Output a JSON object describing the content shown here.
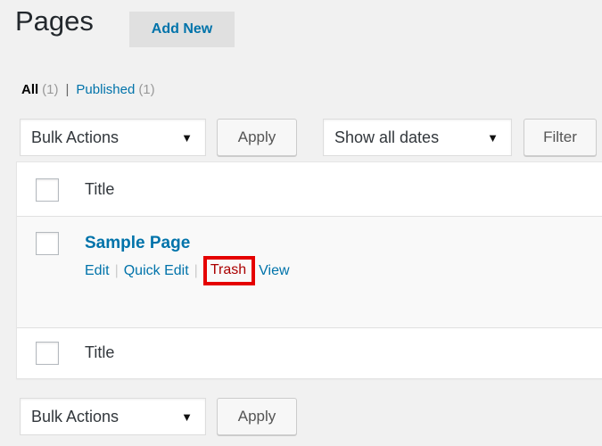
{
  "header": {
    "title": "Pages",
    "add_new_label": "Add New"
  },
  "filters": {
    "all_label": "All",
    "all_count": "(1)",
    "separator": "|",
    "published_label": "Published",
    "published_count": "(1)"
  },
  "top_controls": {
    "bulk_actions": "Bulk Actions",
    "apply_label": "Apply",
    "dates": "Show all dates",
    "filter_label": "Filter"
  },
  "table": {
    "header_title": "Title",
    "footer_title": "Title",
    "rows": [
      {
        "title": "Sample Page",
        "actions": {
          "edit": "Edit",
          "quick_edit": "Quick Edit",
          "trash": "Trash",
          "view": "View",
          "pipe": "|"
        }
      }
    ]
  },
  "bottom_controls": {
    "bulk_actions": "Bulk Actions",
    "apply_label": "Apply"
  },
  "colors": {
    "link": "#0073aa",
    "trash": "#a00000",
    "highlight_box": "#e50000",
    "background": "#f1f1f1"
  },
  "icons": {
    "dropdown_caret": "caret-down-icon"
  }
}
